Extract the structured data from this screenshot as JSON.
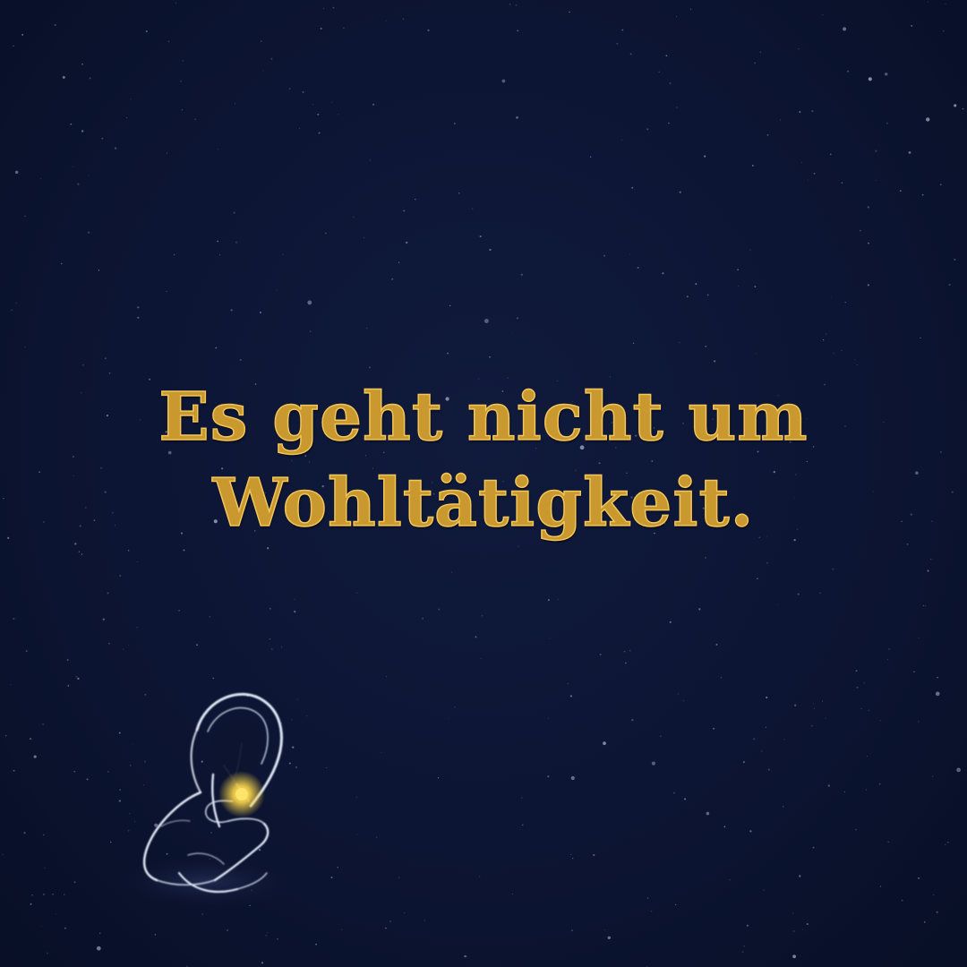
{
  "headline": {
    "line1": "Es geht nicht um",
    "line2": "Wohltätigkeit."
  },
  "colors": {
    "background": "#0b1330",
    "text_gold": "#c9982f",
    "text_highlight": "#f0c55a",
    "figure_outline": "#dfe6f5",
    "glow": "#ffd84a"
  },
  "illustration": {
    "subject": "hooded-figure-crouching-with-light-icon"
  }
}
